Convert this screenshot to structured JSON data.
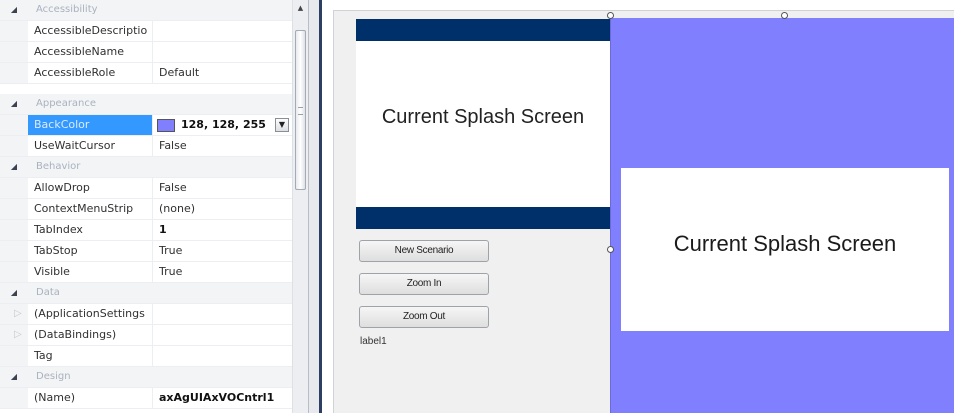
{
  "property_grid": {
    "categories": {
      "accessibility": "Accessibility",
      "appearance": "Appearance",
      "behavior": "Behavior",
      "data": "Data",
      "design": "Design"
    },
    "rows": {
      "accessible_description": {
        "name": "AccessibleDescriptio",
        "value": ""
      },
      "accessible_name": {
        "name": "AccessibleName",
        "value": ""
      },
      "accessible_role": {
        "name": "AccessibleRole",
        "value": "Default"
      },
      "back_color": {
        "name": "BackColor",
        "value": "128, 128, 255",
        "swatch_color": "#8080ff"
      },
      "use_wait_cursor": {
        "name": "UseWaitCursor",
        "value": "False"
      },
      "allow_drop": {
        "name": "AllowDrop",
        "value": "False"
      },
      "context_menu_strip": {
        "name": "ContextMenuStrip",
        "value": "(none)"
      },
      "tab_index": {
        "name": "TabIndex",
        "value": "1"
      },
      "tab_stop": {
        "name": "TabStop",
        "value": "True"
      },
      "visible": {
        "name": "Visible",
        "value": "True"
      },
      "application_settings": {
        "name": "(ApplicationSettings",
        "value": ""
      },
      "data_bindings": {
        "name": "(DataBindings)",
        "value": ""
      },
      "tag": {
        "name": "Tag",
        "value": ""
      },
      "name_prop": {
        "name": "(Name)",
        "value": "axAgUIAxVOCntrl1"
      }
    }
  },
  "designer": {
    "preview_label": "Current Splash Screen",
    "buttons": {
      "new_scenario": "New Scenario",
      "zoom_in": "Zoom In",
      "zoom_out": "Zoom Out"
    },
    "label1": "label1",
    "activex": {
      "back_color": "#8080ff",
      "splash_label": "Current Splash Screen"
    }
  },
  "icons": {
    "collapse": "◢",
    "expand": "▷",
    "dropdown": "▼",
    "scroll_up": "▲"
  },
  "colors": {
    "selection": "#3399ff",
    "header_bar": "#00306a"
  }
}
